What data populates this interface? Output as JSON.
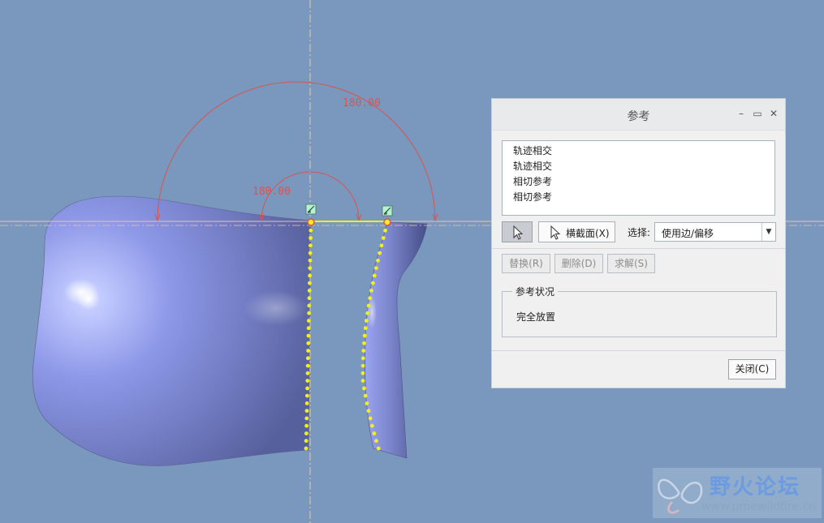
{
  "canvas": {
    "dimension_outer": "180.00",
    "dimension_inner": "180.00",
    "background_color": "#7a98be",
    "surface_color": "#8b95dc",
    "trajectory_color": "#f2ef1c",
    "dimension_color": "#d9534f"
  },
  "dialog": {
    "title": "参考",
    "minimize_icon": "minimize-icon",
    "maximize_icon": "maximize-icon",
    "close_icon": "close-icon",
    "references": [
      "轨迹相交",
      "轨迹相交",
      "相切参考",
      "相切参考"
    ],
    "cross_section_label": "横截面(X)",
    "select_label": "选择:",
    "select_value": "使用边/偏移",
    "replace_label": "替换(R)",
    "delete_label": "删除(D)",
    "solve_label": "求解(S)",
    "status_group_label": "参考状况",
    "status_text": "完全放置",
    "close_label": "关闭(C)"
  },
  "watermark": {
    "title": "野火论坛",
    "url": "www.proewildfire.cn"
  }
}
